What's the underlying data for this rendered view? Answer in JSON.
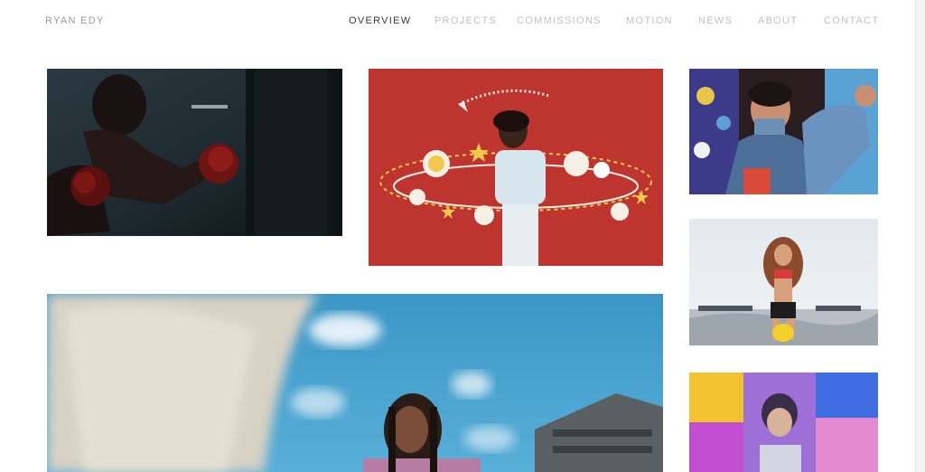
{
  "site": {
    "brand": "RYAN EDY"
  },
  "nav": {
    "items": [
      {
        "label": "OVERVIEW",
        "active": true
      },
      {
        "label": "PROJECTS",
        "active": false
      },
      {
        "label": "COMMISSIONS",
        "active": false
      },
      {
        "label": "MOTION",
        "active": false
      },
      {
        "label": "NEWS",
        "active": false
      },
      {
        "label": "ABOUT",
        "active": false
      },
      {
        "label": "CONTACT",
        "active": false
      }
    ]
  },
  "colors": {
    "text_muted": "#c2c2c2",
    "text_active": "#3a3a3a",
    "brand_text": "#9a9a9a",
    "background": "#ffffff"
  },
  "gallery": {
    "tiles": [
      {
        "subject": "boxer-photo"
      },
      {
        "subject": "red-wall-illustration-photo"
      },
      {
        "subject": "denim-group-photo"
      },
      {
        "subject": "skatepark-photo"
      },
      {
        "subject": "sky-portrait-photo"
      },
      {
        "subject": "color-block-portrait-photo"
      }
    ]
  }
}
